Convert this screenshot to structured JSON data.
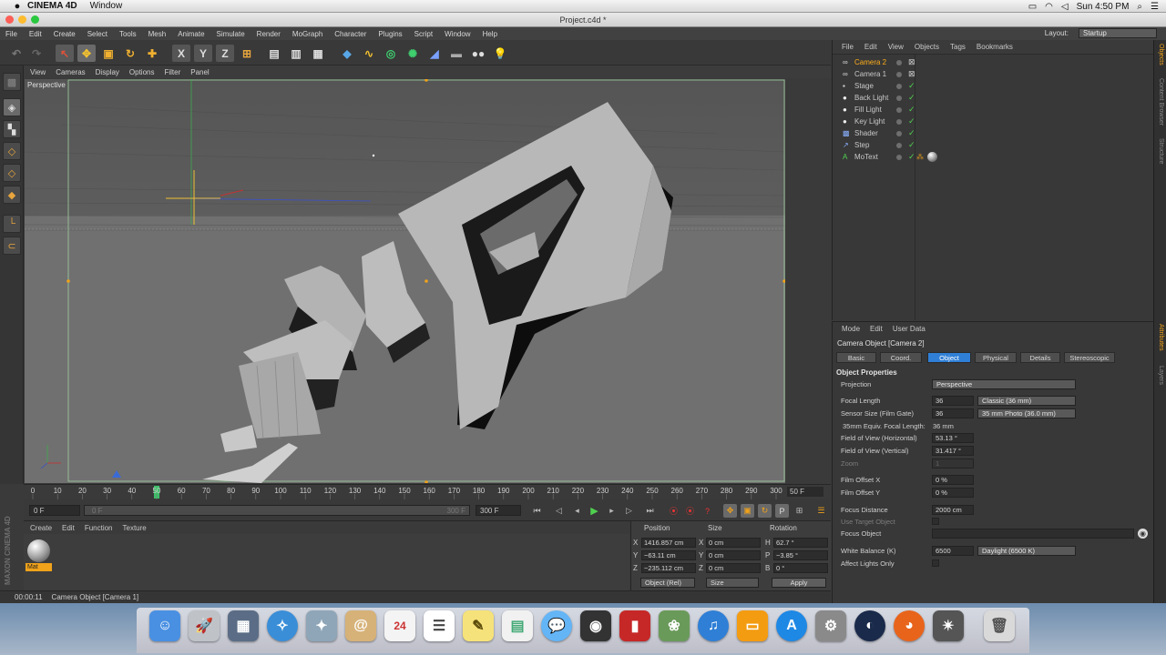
{
  "mac_menu": {
    "app_name": "CINEMA 4D",
    "items": [
      "Window"
    ],
    "status_right": [
      "Sun 4:50 PM"
    ]
  },
  "window": {
    "title": "Project.c4d *"
  },
  "app_menu": [
    "File",
    "Edit",
    "Create",
    "Select",
    "Tools",
    "Mesh",
    "Animate",
    "Simulate",
    "Render",
    "MoGraph",
    "Character",
    "Plugins",
    "Script",
    "Window",
    "Help"
  ],
  "layout": {
    "label": "Layout:",
    "value": "Startup"
  },
  "viewport": {
    "menu": [
      "View",
      "Cameras",
      "Display",
      "Options",
      "Filter",
      "Panel"
    ],
    "label": "Perspective"
  },
  "timeline": {
    "ticks": [
      0,
      10,
      20,
      30,
      40,
      50,
      60,
      70,
      80,
      90,
      100,
      110,
      120,
      130,
      140,
      150,
      160,
      170,
      180,
      190,
      200,
      210,
      220,
      230,
      240,
      250,
      260,
      270,
      280,
      290,
      300
    ],
    "current": 50,
    "end_field": "50 F"
  },
  "transport": {
    "start_field": "0 F",
    "range_start": "0 F",
    "range_end": "300 F",
    "end_field": "300 F"
  },
  "material_manager": {
    "menu": [
      "Create",
      "Edit",
      "Function",
      "Texture"
    ],
    "material_name": "Mat",
    "brand": "MAXON CINEMA 4D"
  },
  "coordinates": {
    "headers": {
      "position": "Position",
      "size": "Size",
      "rotation": "Rotation"
    },
    "rows": [
      {
        "axis": "X",
        "pos": "1416.857 cm",
        "size_axis": "X",
        "size": "0 cm",
        "rot_axis": "H",
        "rot": "62.7 °"
      },
      {
        "axis": "Y",
        "pos": "−63.11 cm",
        "size_axis": "Y",
        "size": "0 cm",
        "rot_axis": "P",
        "rot": "−3.85 °"
      },
      {
        "axis": "Z",
        "pos": "−235.112 cm",
        "size_axis": "Z",
        "size": "0 cm",
        "rot_axis": "B",
        "rot": "0 °"
      }
    ],
    "mode_dropdown": "Object (Rel)",
    "size_dropdown": "Size",
    "apply_label": "Apply"
  },
  "status_bar": {
    "time": "00:00:11",
    "message": "Camera Object [Camera 1]"
  },
  "object_manager": {
    "menu": [
      "File",
      "Edit",
      "View",
      "Objects",
      "Tags",
      "Bookmarks"
    ],
    "objects": [
      {
        "name": "Camera 2",
        "icon": "camera-icon",
        "highlight": true
      },
      {
        "name": "Camera 1",
        "icon": "camera-icon",
        "highlight": false
      },
      {
        "name": "Stage",
        "icon": "stage-icon",
        "highlight": false
      },
      {
        "name": "Back Light",
        "icon": "light-icon",
        "highlight": false
      },
      {
        "name": "Fill Light",
        "icon": "light-icon",
        "highlight": false
      },
      {
        "name": "Key Light",
        "icon": "light-icon",
        "highlight": false
      },
      {
        "name": "Shader",
        "icon": "shader-icon",
        "highlight": false
      },
      {
        "name": "Step",
        "icon": "step-icon",
        "highlight": false
      },
      {
        "name": "MoText",
        "icon": "motext-icon",
        "highlight": false
      }
    ]
  },
  "attribute_manager": {
    "menu": [
      "Mode",
      "Edit",
      "User Data"
    ],
    "title": "Camera Object [Camera 2]",
    "tabs": [
      "Basic",
      "Coord.",
      "Object",
      "Physical",
      "Details",
      "Stereoscopic"
    ],
    "active_tab": "Object",
    "section": "Object Properties",
    "projection_label": "Projection",
    "projection_value": "Perspective",
    "focal_length_label": "Focal Length",
    "focal_length_value": "36",
    "focal_length_preset": "Classic (36 mm)",
    "sensor_label": "Sensor Size (Film Gate)",
    "sensor_value": "36",
    "sensor_preset": "35 mm Photo (36.0 mm)",
    "equiv_label": "35mm Equiv. Focal Length:",
    "equiv_value": "36 mm",
    "fovh_label": "Field of View (Horizontal)",
    "fovh_value": "53.13 °",
    "fovv_label": "Field of View (Vertical)",
    "fovv_value": "31.417 °",
    "zoom_label": "Zoom",
    "zoom_value": "1",
    "offx_label": "Film Offset X",
    "offx_value": "0 %",
    "offy_label": "Film Offset Y",
    "offy_value": "0 %",
    "focus_dist_label": "Focus Distance",
    "focus_dist_value": "2000 cm",
    "use_target_label": "Use Target Object",
    "focus_obj_label": "Focus Object",
    "wb_label": "White Balance (K)",
    "wb_value": "6500",
    "wb_preset": "Daylight (6500 K)",
    "affect_label": "Affect Lights Only"
  },
  "right_strip": [
    "Objects",
    "Content Browser",
    "Structure",
    "Attributes",
    "Layers"
  ],
  "dock_apps": [
    "finder-icon",
    "launchpad-icon",
    "mission-control-icon",
    "safari-icon",
    "preview-icon",
    "mail-icon",
    "calendar-icon",
    "reminders-icon",
    "notes-icon",
    "textedit-icon",
    "messages-icon",
    "facetime-icon",
    "photobooth-icon",
    "iphoto-icon",
    "itunes-icon",
    "ibooks-icon",
    "app-store-icon",
    "system-preferences-icon",
    "cinema4d-icon",
    "firefox-icon",
    "imovie-icon",
    "trash-icon"
  ],
  "dock_calendar_day": "24",
  "colors": {
    "accent_orange": "#f0a21a",
    "active_tab_blue": "#2f7fd6",
    "check_green": "#4fd14f",
    "camera2_text": "#ffae1a"
  }
}
